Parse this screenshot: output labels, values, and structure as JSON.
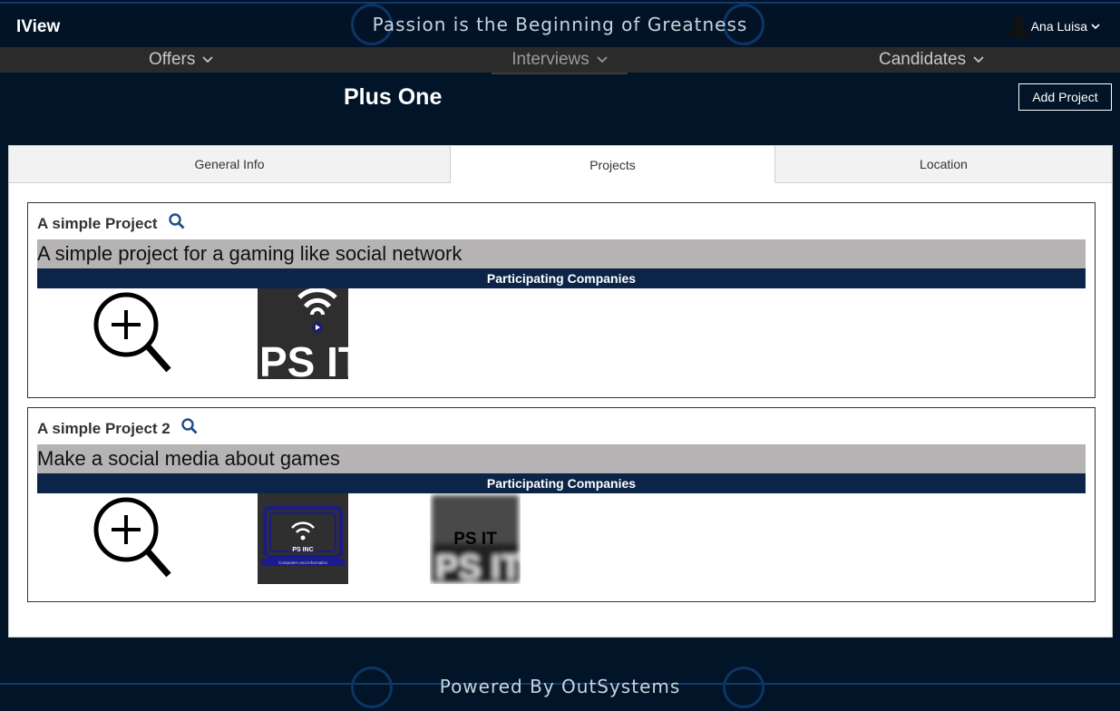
{
  "app": {
    "logo": "IView",
    "slogan": "Passion is the Beginning of Greatness",
    "user_name": "Ana Luisa",
    "user_icon": "user-icon"
  },
  "nav": {
    "items": [
      {
        "label": "Offers"
      },
      {
        "label": "Interviews"
      },
      {
        "label": "Candidates"
      }
    ]
  },
  "page": {
    "title": "Plus One",
    "add_button": "Add Project"
  },
  "tabs": [
    {
      "label": "General Info"
    },
    {
      "label": "Projects"
    },
    {
      "label": "Location"
    }
  ],
  "projects": [
    {
      "name": "A simple Project",
      "description": "A simple project for a gaming like social network",
      "companies_label": "Participating Companies",
      "companies": [
        {
          "logo_text": "PS IT"
        }
      ]
    },
    {
      "name": "A simple Project 2",
      "description": "Make a social media about games",
      "companies_label": "Participating Companies",
      "companies": [
        {
          "logo_text": "PS INC",
          "logo_subtext": "Computers and Informatics"
        },
        {
          "logo_text": "PS IT"
        }
      ]
    }
  ],
  "footer": {
    "text": "Powered By OutSystems"
  },
  "colors": {
    "background": "#021428",
    "accent": "#0b2447",
    "nav": "#2b2b2b",
    "description_bg": "#b5b3b3"
  }
}
